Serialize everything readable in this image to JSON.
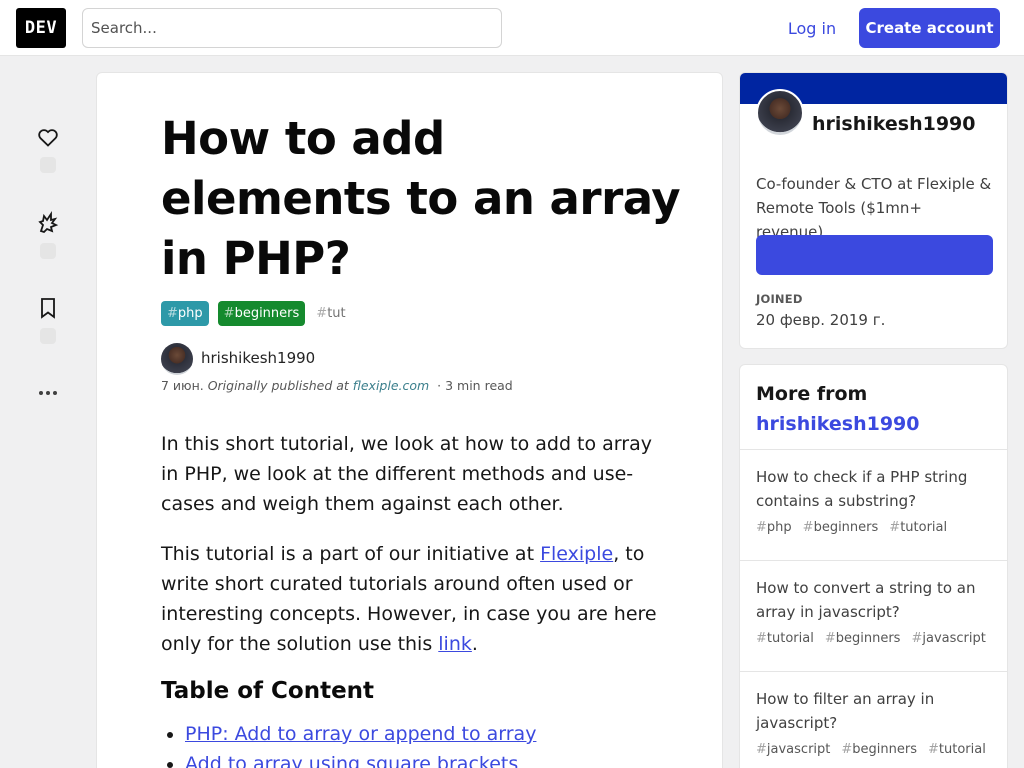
{
  "header": {
    "logo_text": "DEV",
    "search_placeholder": "Search...",
    "login_label": "Log in",
    "create_label": "Create account"
  },
  "sidebar_left": {
    "reactions": [
      {
        "name": "heart-icon",
        "label": "reactions"
      },
      {
        "name": "unicorn-icon",
        "label": "unicorn"
      },
      {
        "name": "bookmark-icon",
        "label": "save"
      }
    ],
    "more_icon": "more-horizontal-icon"
  },
  "article": {
    "title_line1": "How to add",
    "title_line2": "elements to an array",
    "title_line3": "in PHP?",
    "tags": [
      {
        "hash": "#",
        "label": "php",
        "color": "#2d99a8"
      },
      {
        "hash": "#",
        "label": "beginners",
        "color": "#158a2e"
      },
      {
        "hash": "#",
        "label": "tut",
        "color": "#ffffff"
      }
    ],
    "author": "hrishikesh1990",
    "date": "7 июн.",
    "originally": "Originally published at",
    "source": "flexiple.com",
    "dot": "·",
    "read_time": "3 min read",
    "p1": "In this short tutorial, we look at how to add to array in PHP, we look at the different methods and use-cases and weigh them against each other.",
    "p2_a": "This tutorial is a part of our initiative at ",
    "p2_link": "Flexiple",
    "p2_b": ", to write short curated tutorials around often used or interesting concepts. However, in case you are here only for the solution use this ",
    "p2_link2": "link",
    "p2_c": ".",
    "toc_title": "Table of Content",
    "toc": [
      "PHP: Add to array or append to array",
      "Add to array using square brackets"
    ]
  },
  "author_card": {
    "name": "hrishikesh1990",
    "bio": "Co-founder & CTO at Flexiple & Remote Tools ($1mn+ revenue).",
    "follow_label": "",
    "joined_label": "JOINED",
    "joined_date": "20 февр. 2019 г.",
    "band_color": "#0025a1",
    "accent": "#3b49df"
  },
  "more_from": {
    "label": "More from",
    "author": "hrishikesh1990",
    "items": [
      {
        "title": "How to check if a PHP string contains a substring?",
        "tags": [
          "php",
          "beginners",
          "tutorial"
        ]
      },
      {
        "title": "How to convert a string to an array in javascript?",
        "tags": [
          "tutorial",
          "beginners",
          "javascript"
        ]
      },
      {
        "title": "How to filter an array in javascript?",
        "tags": [
          "javascript",
          "beginners",
          "tutorial"
        ]
      }
    ]
  }
}
